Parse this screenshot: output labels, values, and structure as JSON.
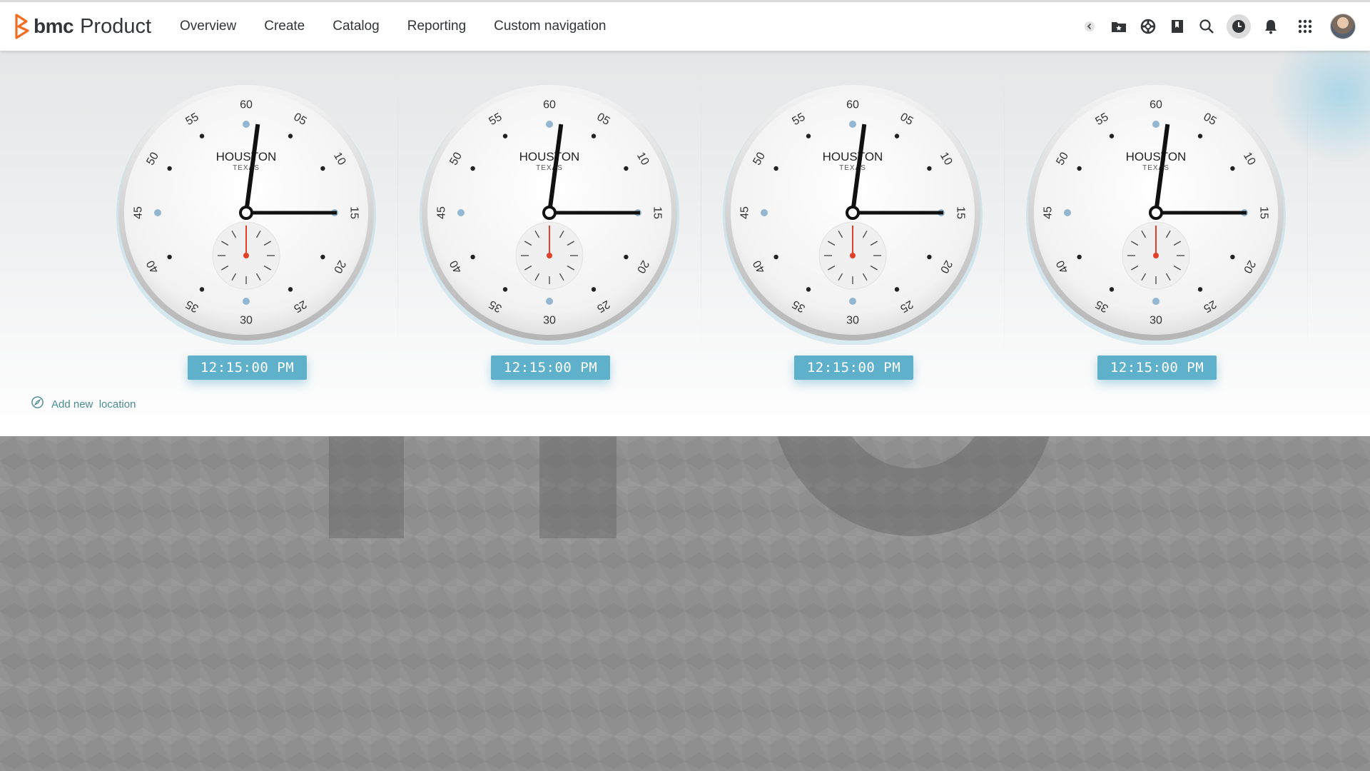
{
  "app": {
    "brand": "bmc",
    "product": "Product",
    "brand_color": "#f26c21"
  },
  "nav": {
    "items": [
      {
        "label": "Overview"
      },
      {
        "label": "Create"
      },
      {
        "label": "Catalog"
      },
      {
        "label": "Reporting"
      },
      {
        "label": "Custom navigation"
      }
    ]
  },
  "header_icons": [
    "collapse-icon",
    "favorites-folder-icon",
    "help-lifebuoy-icon",
    "bookmark-icon",
    "search-icon",
    "clock-icon",
    "bell-icon",
    "apps-grid-icon"
  ],
  "clocks": [
    {
      "city": "HOUSTON",
      "region": "TEXAS",
      "time": "12:15:00 PM",
      "hour": 12,
      "minute": 15,
      "second": 0
    },
    {
      "city": "HOUSTON",
      "region": "TEXAS",
      "time": "12:15:00 PM",
      "hour": 12,
      "minute": 15,
      "second": 0
    },
    {
      "city": "HOUSTON",
      "region": "TEXAS",
      "time": "12:15:00 PM",
      "hour": 12,
      "minute": 15,
      "second": 0
    },
    {
      "city": "HOUSTON",
      "region": "TEXAS",
      "time": "12:15:00 PM",
      "hour": 12,
      "minute": 15,
      "second": 0
    }
  ],
  "dial_labels": [
    "60",
    "05",
    "10",
    "15",
    "20",
    "25",
    "30",
    "35",
    "40",
    "45",
    "50",
    "55"
  ],
  "add_location": {
    "label": "Add new  location"
  },
  "colors": {
    "accent": "#5fb0cb",
    "second_hand": "#e2402a",
    "link": "#4a8b94"
  }
}
